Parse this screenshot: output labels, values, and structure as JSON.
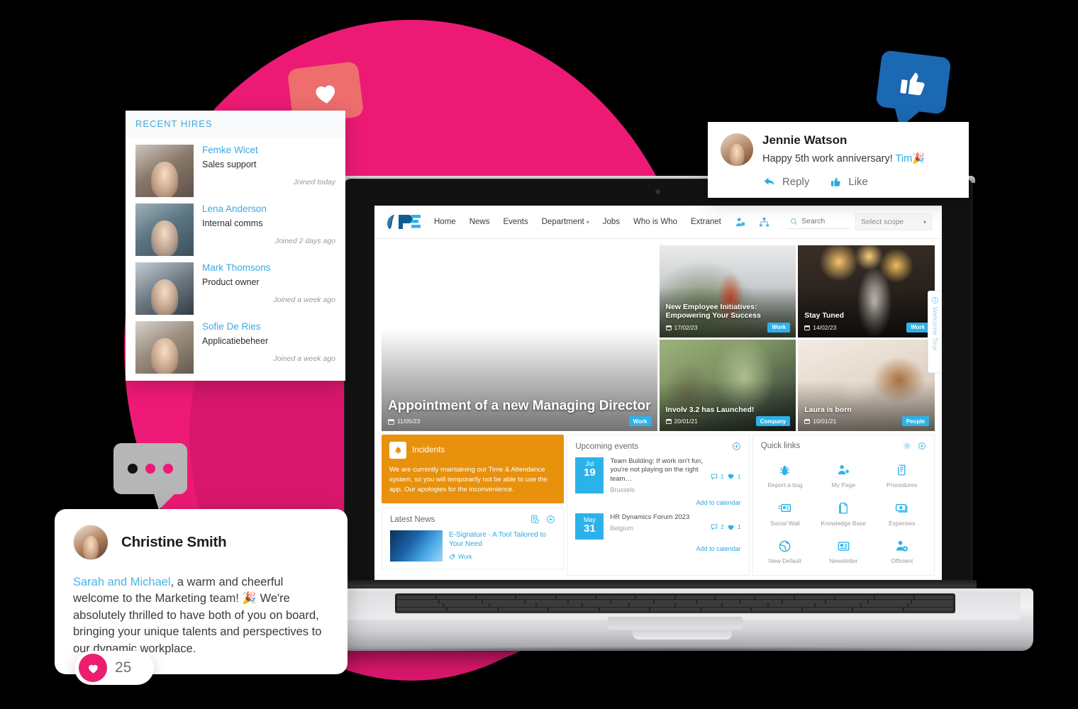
{
  "colors": {
    "brand_pink": "#ED1A75",
    "brand_blue": "#2CB2EA",
    "link_blue": "#2CA9E0",
    "incident_orange": "#E8910D",
    "heart_red": "#EC1E6E",
    "facebook_blue": "#1B68B3",
    "heart_bubble": "#EE6D6D",
    "chat_gray": "#B6B6B6"
  },
  "recent_hires": {
    "title": "RECENT HIRES",
    "items": [
      {
        "name": "Femke Wicet",
        "role": "Sales support",
        "joined": "Joined today"
      },
      {
        "name": "Lena Anderson",
        "role": "Internal comms",
        "joined": "Joined 2 days ago"
      },
      {
        "name": "Mark Thomsons",
        "role": "Product owner",
        "joined": "Joined a week ago"
      },
      {
        "name": "Sofie De Ries",
        "role": "Applicatiebeheer",
        "joined": "Joined a week ago"
      }
    ]
  },
  "jennie_card": {
    "name": "Jennie Watson",
    "message_text": "Happy 5th work anniversary! ",
    "message_mention": "Tim",
    "message_emoji": "🎉",
    "reply_label": "Reply",
    "like_label": "Like"
  },
  "christine_card": {
    "name": "Christine Smith",
    "mention": "Sarah and Michael",
    "body": ", a warm and cheerful welcome to the Marketing team! 🎉 We're absolutely thrilled to have both of you on board, bringing your unique talents and perspectives to our dynamic workplace.",
    "reaction_count": "25"
  },
  "intranet": {
    "nav": {
      "links": [
        {
          "label": "Home",
          "dropdown": false
        },
        {
          "label": "News",
          "dropdown": false
        },
        {
          "label": "Events",
          "dropdown": false
        },
        {
          "label": "Department",
          "dropdown": true
        },
        {
          "label": "Jobs",
          "dropdown": false
        },
        {
          "label": "Who is Who",
          "dropdown": false
        },
        {
          "label": "Extranet",
          "dropdown": false
        }
      ],
      "search_placeholder": "Search",
      "scope_label": "Select scope"
    },
    "hero": {
      "main": {
        "title": "Appointment of a new Managing Director",
        "date": "11/05/23",
        "tag": "Work"
      },
      "tiles": [
        {
          "title": "New Employee Initiatives: Empowering Your Success",
          "date": "17/02/23",
          "tag": "Work"
        },
        {
          "title": "Stay Tuned",
          "date": "14/02/23",
          "tag": "Work"
        },
        {
          "title": "Involv 3.2 has Launched!",
          "date": "20/01/21",
          "tag": "Company"
        },
        {
          "title": "Laura is born",
          "date": "10/01/21",
          "tag": "People"
        }
      ]
    },
    "incidents": {
      "title": "Incidents",
      "body": "We are currently maintaining our Time & Attendance system, so you will temporarily not be able to use the app. Our apologies for the inconvenience."
    },
    "latest_news": {
      "title": "Latest News",
      "items": [
        {
          "title": "E-Signature - A Tool Tailored to Your Need",
          "tag": "Work"
        }
      ]
    },
    "upcoming_events": {
      "title": "Upcoming events",
      "add_to_calendar": "Add to calendar",
      "items": [
        {
          "month": "Jul",
          "day": "19",
          "title": "Team Building: If work isn't fun, you're not playing on the right team…",
          "location": "Brussels",
          "comments": "1",
          "likes": "1"
        },
        {
          "month": "May",
          "day": "31",
          "title": "HR Dynamics Forum 2023",
          "location": "Belgium",
          "comments": "2",
          "likes": "1"
        }
      ]
    },
    "quick_links": {
      "title": "Quick links",
      "items": [
        {
          "label": "Report a bug",
          "icon": "bug-icon"
        },
        {
          "label": "My Page",
          "icon": "user-star-icon"
        },
        {
          "label": "Procedures",
          "icon": "scroll-icon"
        },
        {
          "label": "Social Wall",
          "icon": "feed-icon"
        },
        {
          "label": "Knowledge Base",
          "icon": "pages-icon"
        },
        {
          "label": "Expenses",
          "icon": "money-icon"
        },
        {
          "label": "New Default",
          "icon": "globe-icon"
        },
        {
          "label": "Newsletter",
          "icon": "newspaper-icon"
        },
        {
          "label": "Officient",
          "icon": "user-add-icon"
        }
      ]
    },
    "welcome_tour": {
      "label": "Welcome Tour"
    }
  }
}
